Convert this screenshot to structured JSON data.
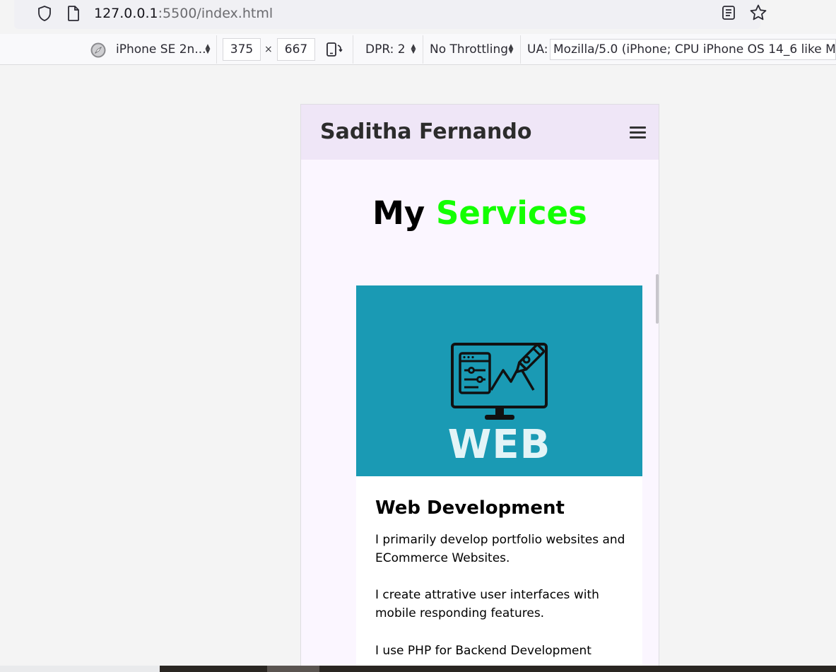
{
  "browser": {
    "url_host": "127.0.0.1",
    "url_path": ":5500/index.html",
    "icons": [
      "shield-icon",
      "page-icon",
      "reader-view-icon",
      "bookmark-star-icon"
    ]
  },
  "responsive_toolbar": {
    "device": "iPhone SE 2n...",
    "width": "375",
    "times": "×",
    "height": "667",
    "dpr": "DPR: 2",
    "throttling": "No Throttling",
    "ua_label": "UA:",
    "ua_value": "Mozilla/5.0 (iPhone; CPU iPhone OS 14_6 like Mac"
  },
  "site": {
    "logo": "Saditha Fernando",
    "menu_icon": "hamburger-menu-icon",
    "section_title_part1": "My",
    "section_title_part2": "Services",
    "accent_color": "#13ff00",
    "card": {
      "image_text": "WEB",
      "image_bg": "#1a9ab4",
      "title": "Web Development",
      "paragraph_1": "I primarily develop portfolio websites and ECommerce Websites.",
      "paragraph_2": "I create attrative user interfaces with mobile responding features.",
      "paragraph_3": "I use PHP for Backend Development"
    }
  }
}
